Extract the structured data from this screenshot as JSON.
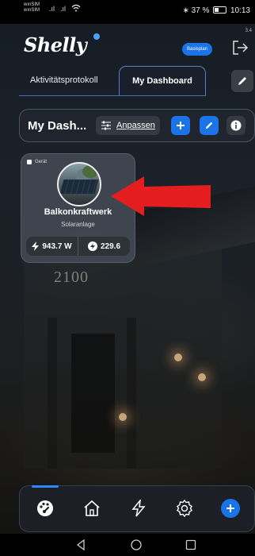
{
  "status_bar": {
    "carrier_1": "wınSIM",
    "carrier_2": "wınSIM",
    "signal_1": ".ıl",
    "signal_2": ".ıl",
    "battery": "37 %",
    "time": "10:13"
  },
  "header": {
    "logo": "Shelly",
    "plan_badge": "Basisplan",
    "version": "3.4"
  },
  "tabs": {
    "activity": "Aktivitätsprotokoll",
    "dashboard": "My Dashboard"
  },
  "toolbar": {
    "title": "My Dash...",
    "customize": "Anpassen"
  },
  "card": {
    "tag": "Gerät",
    "name": "Balkonkraftwerk",
    "type": "Solaranlage",
    "power": "943.7 W",
    "energy": "229.6"
  },
  "background": {
    "house_number": "2100"
  },
  "colors": {
    "accent": "#1a73e8",
    "annotation_arrow": "#e41e1e",
    "card_bg": "#424852"
  },
  "icons": {
    "nav": [
      "dashboard-icon",
      "home-icon",
      "energy-icon",
      "settings-icon",
      "add-icon"
    ],
    "system_nav": [
      "back-icon",
      "home-circle-icon",
      "recents-icon"
    ]
  }
}
